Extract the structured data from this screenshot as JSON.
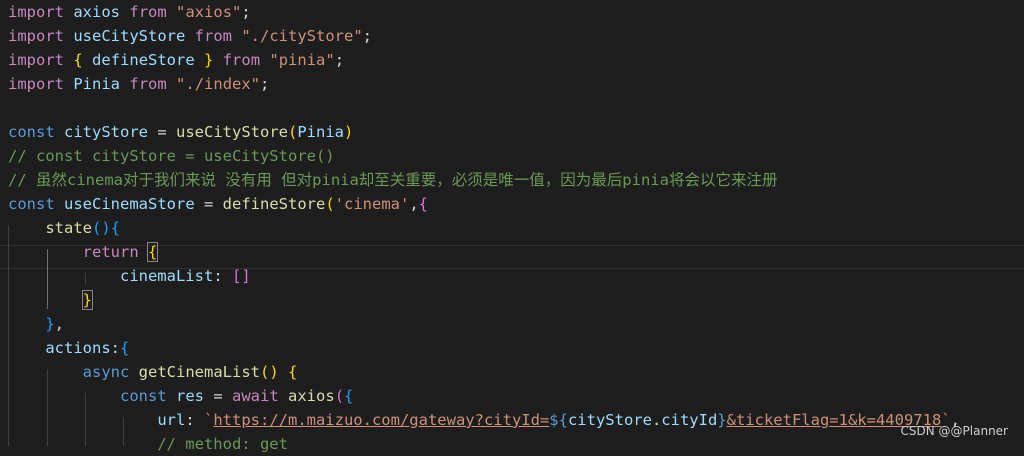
{
  "editor": {
    "watermark": "CSDN @@Planner",
    "lines": [
      [
        [
          "c",
          "import"
        ],
        [
          "p",
          " "
        ],
        [
          "v",
          "axios"
        ],
        [
          "p",
          " "
        ],
        [
          "c",
          "from"
        ],
        [
          "p",
          " "
        ],
        [
          "s",
          "\"axios\""
        ],
        [
          "p",
          ";"
        ]
      ],
      [
        [
          "c",
          "import"
        ],
        [
          "p",
          " "
        ],
        [
          "v",
          "useCityStore"
        ],
        [
          "p",
          " "
        ],
        [
          "c",
          "from"
        ],
        [
          "p",
          " "
        ],
        [
          "s",
          "\"./cityStore\""
        ],
        [
          "p",
          ";"
        ]
      ],
      [
        [
          "c",
          "import"
        ],
        [
          "p",
          " "
        ],
        [
          "g1",
          "{"
        ],
        [
          "p",
          " "
        ],
        [
          "v",
          "defineStore"
        ],
        [
          "p",
          " "
        ],
        [
          "g1",
          "}"
        ],
        [
          "p",
          " "
        ],
        [
          "c",
          "from"
        ],
        [
          "p",
          " "
        ],
        [
          "s",
          "\"pinia\""
        ],
        [
          "p",
          ";"
        ]
      ],
      [
        [
          "c",
          "import"
        ],
        [
          "p",
          " "
        ],
        [
          "v",
          "Pinia"
        ],
        [
          "p",
          " "
        ],
        [
          "c",
          "from"
        ],
        [
          "p",
          " "
        ],
        [
          "s",
          "\"./index\""
        ],
        [
          "p",
          ";"
        ]
      ],
      [],
      [
        [
          "k",
          "const"
        ],
        [
          "p",
          " "
        ],
        [
          "v",
          "cityStore"
        ],
        [
          "p",
          " = "
        ],
        [
          "f",
          "useCityStore"
        ],
        [
          "g1",
          "("
        ],
        [
          "v",
          "Pinia"
        ],
        [
          "g1",
          ")"
        ]
      ],
      [
        [
          "m",
          "// const cityStore = useCityStore()"
        ]
      ],
      [
        [
          "m",
          "// 虽然cinema对于我们来说 没有用 但对pinia却至关重要，必须是唯一值，因为最后pinia将会以它来注册"
        ]
      ],
      [
        [
          "k",
          "const"
        ],
        [
          "p",
          " "
        ],
        [
          "v",
          "useCinemaStore"
        ],
        [
          "p",
          " = "
        ],
        [
          "f",
          "defineStore"
        ],
        [
          "g1",
          "("
        ],
        [
          "s",
          "'cinema'"
        ],
        [
          "p",
          ","
        ],
        [
          "g2",
          "{"
        ]
      ],
      [
        [
          "p",
          "    "
        ],
        [
          "f",
          "state"
        ],
        [
          "g3",
          "("
        ],
        [
          "g3",
          ")"
        ],
        [
          "g3",
          "{"
        ]
      ],
      [
        [
          "p",
          "        "
        ],
        [
          "c",
          "return"
        ],
        [
          "p",
          " "
        ],
        [
          "g1b",
          "{"
        ]
      ],
      [
        [
          "p",
          "            "
        ],
        [
          "v",
          "cinemaList"
        ],
        [
          "p",
          ": "
        ],
        [
          "g2",
          "["
        ],
        [
          "g2",
          "]"
        ]
      ],
      [
        [
          "p",
          "        "
        ],
        [
          "g1b",
          "}"
        ]
      ],
      [
        [
          "p",
          "    "
        ],
        [
          "g3",
          "}"
        ],
        [
          "p",
          ","
        ]
      ],
      [
        [
          "p",
          "    "
        ],
        [
          "v",
          "actions"
        ],
        [
          "p",
          ":"
        ],
        [
          "g3",
          "{"
        ]
      ],
      [
        [
          "p",
          "        "
        ],
        [
          "k",
          "async"
        ],
        [
          "p",
          " "
        ],
        [
          "f",
          "getCinemaList"
        ],
        [
          "g1",
          "("
        ],
        [
          "g1",
          ")"
        ],
        [
          "p",
          " "
        ],
        [
          "g1",
          "{"
        ]
      ],
      [
        [
          "p",
          "            "
        ],
        [
          "k",
          "const"
        ],
        [
          "p",
          " "
        ],
        [
          "v",
          "res"
        ],
        [
          "p",
          " = "
        ],
        [
          "c",
          "await"
        ],
        [
          "p",
          " "
        ],
        [
          "f",
          "axios"
        ],
        [
          "g2",
          "("
        ],
        [
          "g3",
          "{"
        ]
      ],
      [
        [
          "p",
          "                "
        ],
        [
          "v",
          "url"
        ],
        [
          "p",
          ": "
        ],
        [
          "s",
          "`"
        ],
        [
          "su",
          "https://m.maizuo.com/gateway?cityId="
        ],
        [
          "k",
          "${"
        ],
        [
          "v",
          "cityStore"
        ],
        [
          "p",
          "."
        ],
        [
          "v",
          "cityId"
        ],
        [
          "k",
          "}"
        ],
        [
          "su",
          "&ticketFlag=1&k=4409718"
        ],
        [
          "s",
          "`"
        ],
        [
          "p",
          ","
        ]
      ],
      [
        [
          "p",
          "                "
        ],
        [
          "m",
          "// method: get"
        ]
      ]
    ]
  }
}
